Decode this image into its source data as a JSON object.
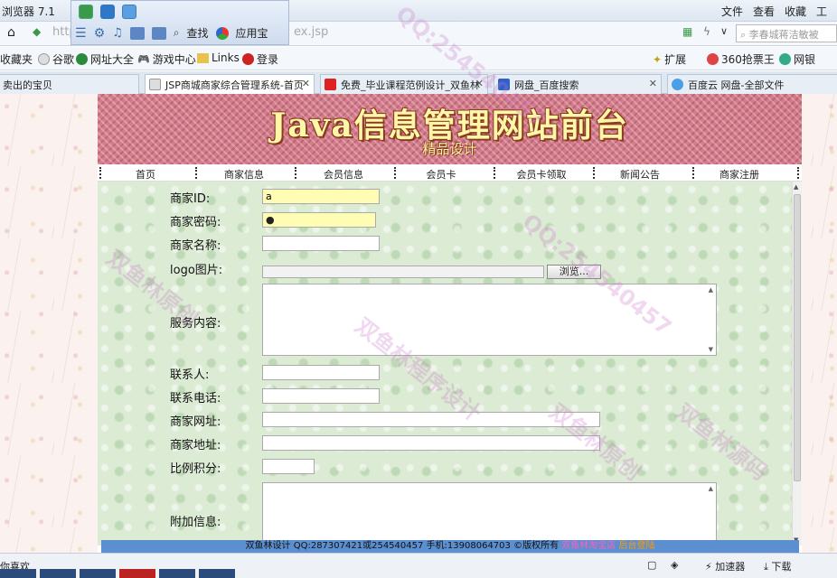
{
  "browser": {
    "app_title": "浏览器 7.1",
    "menu": [
      "文件",
      "查看",
      "收藏",
      "工具"
    ],
    "url_prefix": "http",
    "url_suffix": "ex.jsp",
    "quick_find": "查找",
    "quick_app": "应用宝",
    "search_placeholder": "李春城蒋洁敏被",
    "bookmarks": [
      "收藏夹",
      "谷歌",
      "网址大全",
      "游戏中心",
      "Links",
      "登录"
    ],
    "bookmarks_right": [
      "扩展",
      "360抢票王",
      "网银"
    ],
    "tabs": [
      {
        "label": "卖出的宝贝",
        "active": false
      },
      {
        "label": "JSP商城商家综合管理系统-首页",
        "active": true
      },
      {
        "label": "免费_毕业课程范例设计_双鱼林",
        "active": false
      },
      {
        "label": "网盘_百度搜索",
        "active": false
      },
      {
        "label": "百度云 网盘-全部文件",
        "active": false
      }
    ],
    "status_left": "你喜欢",
    "status_right": [
      "加速器",
      "下载"
    ]
  },
  "site": {
    "title": "Java信息管理网站前台",
    "subtitle": "精品设计",
    "nav": [
      "首页",
      "商家信息",
      "会员信息",
      "会员卡",
      "会员卡领取",
      "新闻公告",
      "商家注册"
    ]
  },
  "form": {
    "merchant_id_label": "商家ID:",
    "merchant_id_value": "a",
    "password_label": "商家密码:",
    "password_value": "●",
    "name_label": "商家名称:",
    "logo_label": "logo图片:",
    "browse_label": "浏览...",
    "service_label": "服务内容:",
    "contact_label": "联系人:",
    "phone_label": "联系电话:",
    "website_label": "商家网址:",
    "address_label": "商家地址:",
    "ratio_label": "比例积分:",
    "extra_label": "附加信息:"
  },
  "footer": {
    "text": "双鱼林设计 QQ:287307421或254540457 手机:13908064703 ©版权所有",
    "link1": "双鱼林淘宝店",
    "link2": "后台登陆"
  },
  "watermarks": [
    "QQ:254540457",
    "双鱼林原创",
    "双鱼林程序设计",
    "QQ:254540457",
    "双鱼林源码",
    "双鱼林原创"
  ]
}
